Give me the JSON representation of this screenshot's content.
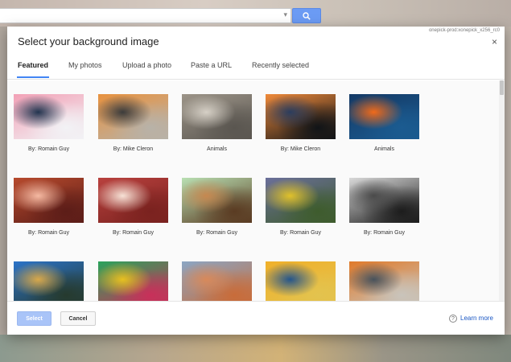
{
  "search": {
    "placeholder": "",
    "caret": "▾"
  },
  "dialog": {
    "corner_id": "onepick-prod:xonepick_x256_rc0",
    "title": "Select your background image",
    "close": "×",
    "tabs": [
      {
        "label": "Featured",
        "active": true
      },
      {
        "label": "My photos",
        "active": false
      },
      {
        "label": "Upload a photo",
        "active": false
      },
      {
        "label": "Paste a URL",
        "active": false
      },
      {
        "label": "Recently selected",
        "active": false
      }
    ],
    "rows": [
      [
        {
          "caption": "By: Romain Guy",
          "palette": [
            "#f2a1b6",
            "#22344f",
            "#f2f2f5"
          ]
        },
        {
          "caption": "By: Mike Cleron",
          "palette": [
            "#e8923f",
            "#3b3b3b",
            "#b8b2a8"
          ]
        },
        {
          "caption": "Animals",
          "palette": [
            "#9c9488",
            "#d6d0c6",
            "#5a5650"
          ]
        },
        {
          "caption": "By: Mike Cleron",
          "palette": [
            "#f08a3a",
            "#2b3d5e",
            "#111417"
          ]
        },
        {
          "caption": "Animals",
          "palette": [
            "#143a66",
            "#f06a1a",
            "#1b5b90"
          ]
        }
      ],
      [
        {
          "caption": "By: Romain Guy",
          "palette": [
            "#b74a2d",
            "#f5b9a2",
            "#5c1d18"
          ]
        },
        {
          "caption": "By: Romain Guy",
          "palette": [
            "#b9413e",
            "#f7e2d6",
            "#7a221f"
          ]
        },
        {
          "caption": "By: Romain Guy",
          "palette": [
            "#b9e0b3",
            "#c68850",
            "#5a3b22"
          ]
        },
        {
          "caption": "By: Romain Guy",
          "palette": [
            "#6b6f9a",
            "#e0c12a",
            "#3e5c2d"
          ]
        },
        {
          "caption": "By: Romain Guy",
          "palette": [
            "#d9d9d9",
            "#4a4a4a",
            "#1c1c1c"
          ]
        }
      ],
      [
        {
          "caption": "",
          "palette": [
            "#2b73c8",
            "#d8a84a",
            "#263a2e"
          ]
        },
        {
          "caption": "",
          "palette": [
            "#2aa35b",
            "#e7c020",
            "#c8305a"
          ]
        },
        {
          "caption": "",
          "palette": [
            "#8ba6c4",
            "#d8895a",
            "#c86c3a"
          ]
        },
        {
          "caption": "",
          "palette": [
            "#f0b02a",
            "#24558c",
            "#e3c34e"
          ]
        },
        {
          "caption": "",
          "palette": [
            "#e07a2a",
            "#47525c",
            "#c9c4bb"
          ]
        }
      ]
    ],
    "buttons": {
      "select": "Select",
      "cancel": "Cancel"
    },
    "help_glyph": "?",
    "learn_more": "Learn more"
  },
  "colors": {
    "accent": "#4285f4",
    "link": "#1a57c4",
    "select_disabled": "#a9c4f8"
  }
}
